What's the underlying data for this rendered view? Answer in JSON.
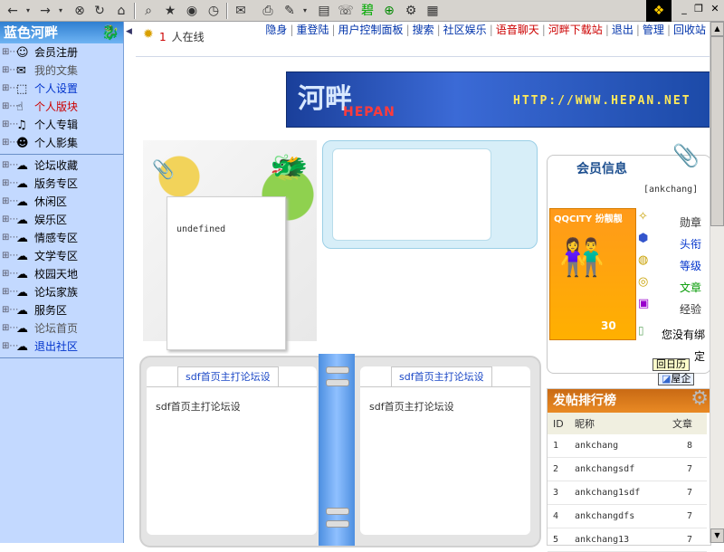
{
  "toolbar": {
    "icons": [
      "back-icon",
      "forward-icon",
      "stop-icon",
      "refresh-icon",
      "home-icon",
      "search-icon",
      "favorites-icon",
      "media-icon",
      "history-icon",
      "mail-icon",
      "print-icon",
      "edit-icon",
      "discuss-icon",
      "messenger-icon",
      "globe-icon",
      "tools-icon",
      "notes-icon"
    ]
  },
  "sidebar": {
    "brand": "蓝色河畔",
    "items": [
      {
        "label": "会员注册",
        "color": "#000000"
      },
      {
        "label": "我的文集",
        "color": "#555555"
      },
      {
        "label": "个人设置",
        "color": "#0033cc"
      },
      {
        "label": "个人版块",
        "color": "#cc0000"
      },
      {
        "label": "个人专辑",
        "color": "#000000"
      },
      {
        "label": "个人影集",
        "color": "#000000"
      }
    ],
    "forums": [
      {
        "label": "论坛收藏",
        "color": "#000000"
      },
      {
        "label": "版务专区",
        "color": "#000000"
      },
      {
        "label": "休闲区",
        "color": "#000000"
      },
      {
        "label": "娱乐区",
        "color": "#000000"
      },
      {
        "label": "情感专区",
        "color": "#000000"
      },
      {
        "label": "文学专区",
        "color": "#000000"
      },
      {
        "label": "校园天地",
        "color": "#000000"
      },
      {
        "label": "论坛家族",
        "color": "#000000"
      },
      {
        "label": "服务区",
        "color": "#000000"
      },
      {
        "label": "论坛首页",
        "color": "#555555"
      },
      {
        "label": "退出社区",
        "color": "#0033cc"
      }
    ]
  },
  "header": {
    "online_count": "1",
    "online_label": "人在线",
    "links": [
      {
        "label": "隐身",
        "hot": false
      },
      {
        "label": "重登陆",
        "hot": false
      },
      {
        "label": "用户控制面板",
        "hot": false
      },
      {
        "label": "搜索",
        "hot": false
      },
      {
        "label": "社区娱乐",
        "hot": false
      },
      {
        "label": "语音聊天",
        "hot": true
      },
      {
        "label": "河畔下载站",
        "hot": true
      },
      {
        "label": "退出",
        "hot": false
      },
      {
        "label": "管理",
        "hot": false
      },
      {
        "label": "回收站",
        "hot": false
      }
    ]
  },
  "banner": {
    "logo": "河畔",
    "sub": "HEPAN",
    "url": "HTTP://WWW.HEPAN.NET"
  },
  "left_card": {
    "text": "undefined"
  },
  "member": {
    "title": "会员信息",
    "username": "[ankchang]",
    "avatar_brand": "QQCITY 扮靓靓",
    "avatar_score": "30",
    "stats": [
      "勋章",
      "头衔",
      "等级",
      "文章",
      "经验"
    ],
    "notice": "您没有绑定",
    "calendar_btn": "回日历",
    "house_btn": "屋企"
  },
  "notebook": {
    "left_tab": "sdf首页主打论坛设",
    "left_text": "sdf首页主打论坛设",
    "right_tab": "sdf首页主打论坛设",
    "right_text": "sdf首页主打论坛设"
  },
  "ranking": {
    "title": "发帖排行榜",
    "headers": [
      "ID",
      "昵称",
      "文章"
    ],
    "rows": [
      [
        "1",
        "ankchang",
        "8"
      ],
      [
        "2",
        "ankchangsdf",
        "7"
      ],
      [
        "3",
        "ankchang1sdf",
        "7"
      ],
      [
        "4",
        "ankchangdfs",
        "7"
      ],
      [
        "5",
        "ankchang13",
        "7"
      ]
    ]
  }
}
